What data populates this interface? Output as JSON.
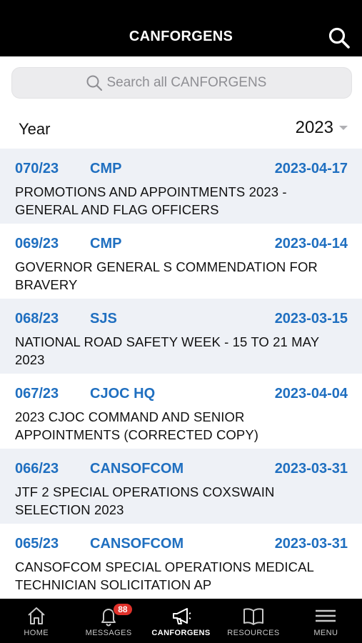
{
  "header": {
    "title": "CANFORGENS"
  },
  "search": {
    "placeholder": "Search all CANFORGENS"
  },
  "filter": {
    "label": "Year",
    "value": "2023"
  },
  "items": [
    {
      "number": "070/23",
      "org": "CMP",
      "date": "2023-04-17",
      "title_line1": "PROMOTIONS AND APPOINTMENTS 2023 -",
      "title_line2": "GENERAL AND FLAG OFFICERS"
    },
    {
      "number": "069/23",
      "org": "CMP",
      "date": "2023-04-14",
      "title_line1": "GOVERNOR GENERAL S COMMENDATION FOR",
      "title_line2": "BRAVERY"
    },
    {
      "number": "068/23",
      "org": "SJS",
      "date": "2023-03-15",
      "title_line1": "NATIONAL ROAD SAFETY WEEK - 15 TO 21 MAY",
      "title_line2": "2023"
    },
    {
      "number": "067/23",
      "org": "CJOC HQ",
      "date": "2023-04-04",
      "title_line1": "2023 CJOC COMMAND AND SENIOR",
      "title_line2": "APPOINTMENTS (CORRECTED COPY)"
    },
    {
      "number": "066/23",
      "org": "CANSOFCOM",
      "date": "2023-03-31",
      "title_line1": "JTF 2 SPECIAL OPERATIONS COXSWAIN",
      "title_line2": "SELECTION 2023"
    },
    {
      "number": "065/23",
      "org": "CANSOFCOM",
      "date": "2023-03-31",
      "title_line1": "CANSOFCOM SPECIAL OPERATIONS MEDICAL",
      "title_line2": "TECHNICIAN SOLICITATION AP"
    }
  ],
  "tabs": [
    {
      "label": "HOME",
      "icon": "home-icon"
    },
    {
      "label": "MESSAGES",
      "icon": "bell-icon",
      "badge": "88"
    },
    {
      "label": "CANFORGENS",
      "icon": "megaphone-icon",
      "active": true
    },
    {
      "label": "RESOURCES",
      "icon": "book-icon"
    },
    {
      "label": "MENU",
      "icon": "menu-icon"
    }
  ],
  "colors": {
    "accent": "#1f6fc0",
    "header_bg": "#000000",
    "row_shade": "#eef1f6",
    "badge": "#e0322b"
  }
}
